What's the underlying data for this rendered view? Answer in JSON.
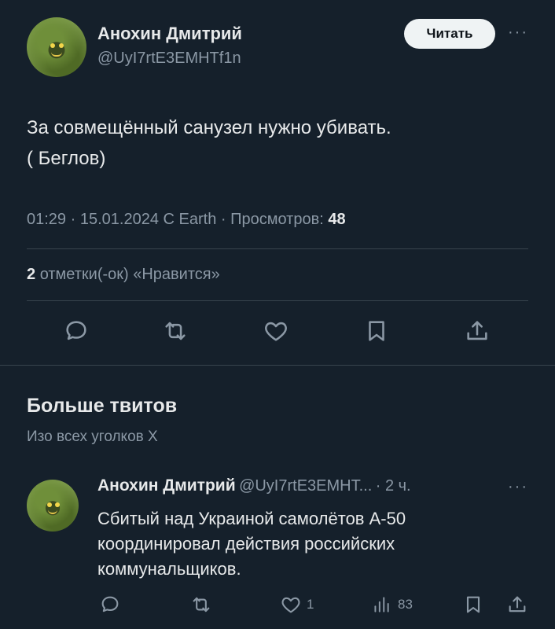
{
  "tweet": {
    "author_name": "Анохин Дмитрий",
    "author_handle": "@UyI7rtE3EMHTf1n",
    "read_label": "Читать",
    "more_icon": "ellipsis-icon",
    "text_line1": "За совмещённый санузел нужно убивать.",
    "text_line2": "( Беглов)",
    "time": "01:29",
    "date": "15.01.2024",
    "source": "С Earth",
    "views_label": "Просмотров:",
    "views_count": "48",
    "likes_count": "2",
    "likes_label": "отметки(-ок) «Нравится»"
  },
  "more_tweets": {
    "title": "Больше твитов",
    "subtitle": "Изо всех уголков X"
  },
  "suggested": {
    "author_name": "Анохин Дмитрий",
    "author_handle": "@UyI7rtE3EMHT...",
    "age": "· 2 ч.",
    "text_line1": "Сбитый над Украиной самолётов А-50",
    "text_line2": "координировал действия российских",
    "text_line3": "коммунальщиков.",
    "likes": "1",
    "views": "83"
  },
  "colors": {
    "background": "#15202b",
    "text": "#e7e9ea",
    "muted": "#8b98a5",
    "divider": "#38444d",
    "button_bg": "#eff3f4"
  }
}
